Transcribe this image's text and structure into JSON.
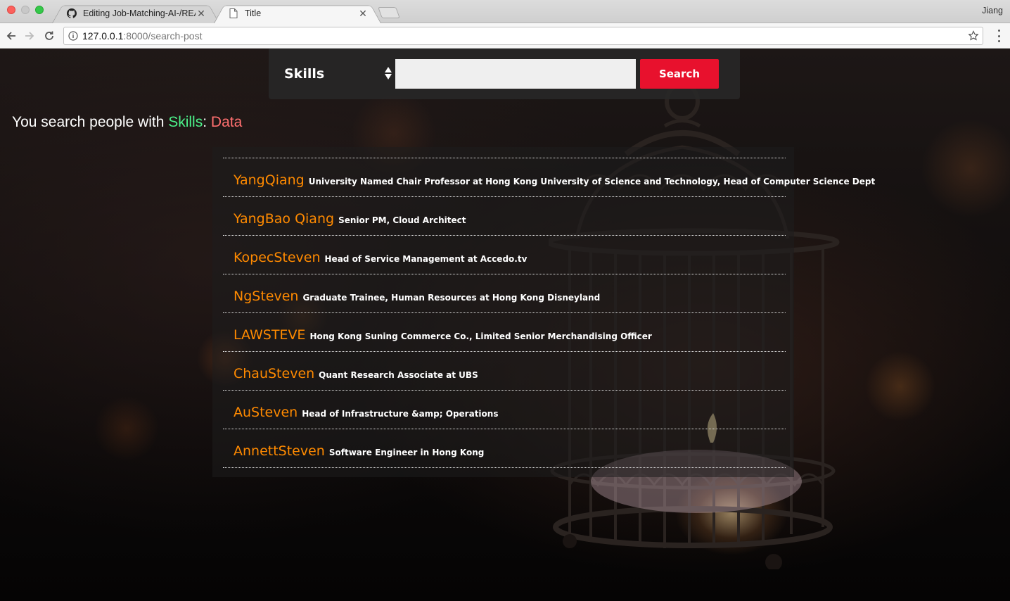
{
  "browser": {
    "tabs": [
      {
        "title": "Editing Job-Matching-AI-/REA",
        "icon": "github-icon",
        "active": false
      },
      {
        "title": "Title",
        "icon": "page-icon",
        "active": true
      }
    ],
    "profile_name": "Jiang",
    "url_host": "127.0.0.1",
    "url_path": ":8000/search-post"
  },
  "search": {
    "field_selected": "Skills",
    "query": "",
    "button_label": "Search",
    "button_color": "#e8112d"
  },
  "summary": {
    "prefix": "You search people with ",
    "field": "Skills",
    "separator": ": ",
    "value": "Data",
    "field_color": "#4cf28a",
    "value_color": "#ff6f6f"
  },
  "results": [
    {
      "name": "YangQiang",
      "title": "University Named Chair Professor at Hong Kong University of Science and Technology, Head of Computer Science Dept"
    },
    {
      "name": "YangBao Qiang",
      "title": "Senior PM, Cloud Architect"
    },
    {
      "name": "KopecSteven",
      "title": "Head of Service Management at Accedo.tv"
    },
    {
      "name": "NgSteven",
      "title": "Graduate Trainee, Human Resources at Hong Kong Disneyland"
    },
    {
      "name": "LAWSTEVE",
      "title": "Hong Kong Suning Commerce Co., Limited Senior Merchandising Officer"
    },
    {
      "name": "ChauSteven",
      "title": "Quant Research Associate at UBS"
    },
    {
      "name": "AuSteven",
      "title": "Head of Infrastructure &amp; Operations"
    },
    {
      "name": "AnnettSteven",
      "title": "Software Engineer in Hong Kong"
    }
  ],
  "colors": {
    "name_accent": "#ff8a00"
  }
}
